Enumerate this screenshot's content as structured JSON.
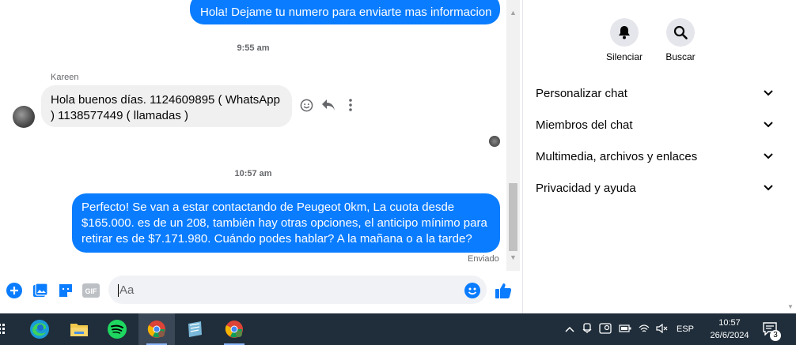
{
  "chat": {
    "messages": {
      "outgoing_top": "Hola! Dejame tu numero para enviarte mas informacion",
      "timestamp_1": "9:55 am",
      "sender_name": "Kareen",
      "incoming_text": "Hola buenos días. 1124609895 ( WhatsApp ) 1138577449 ( llamadas )",
      "timestamp_2": "10:57 am",
      "outgoing_main": "Perfecto!  Se van a estar contactando de Peugeot 0km, La cuota desde $165.000. es de un 208, también hay otras opciones, el anticipo mínimo para retirar es de $7.171.980. Cuándo podes hablar? A la mañana o a la tarde?",
      "status": "Enviado"
    },
    "composer": {
      "placeholder": "Aa"
    }
  },
  "right_panel": {
    "mute_label": "Silenciar",
    "search_label": "Buscar",
    "menu": [
      {
        "label": "Personalizar chat"
      },
      {
        "label": "Miembros del chat"
      },
      {
        "label": "Multimedia, archivos y enlaces"
      },
      {
        "label": "Privacidad y ayuda"
      }
    ]
  },
  "taskbar": {
    "language": "ESP",
    "time": "10:57",
    "date": "26/6/2024",
    "notification_count": "3"
  },
  "colors": {
    "messenger_blue": "#0a7cff",
    "taskbar_bg": "#202e3b",
    "bubble_gray": "#f0f0f0"
  }
}
